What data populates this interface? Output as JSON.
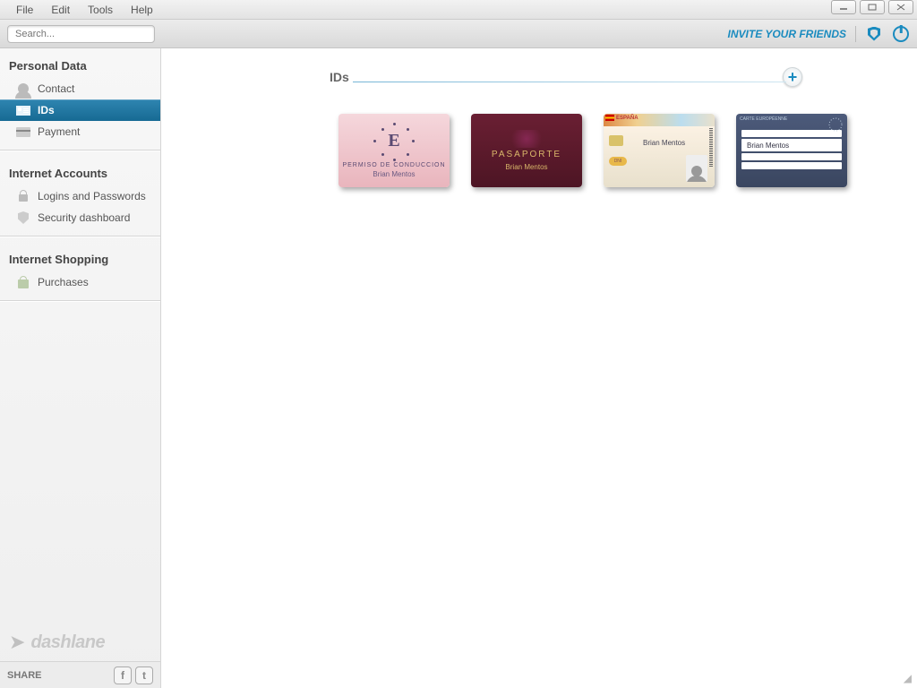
{
  "menu": {
    "file": "File",
    "edit": "Edit",
    "tools": "Tools",
    "help": "Help"
  },
  "search": {
    "placeholder": "Search..."
  },
  "header": {
    "invite": "INVITE YOUR FRIENDS"
  },
  "sidebar": {
    "personal": {
      "title": "Personal Data",
      "contact": "Contact",
      "ids": "IDs",
      "payment": "Payment"
    },
    "internet": {
      "title": "Internet Accounts",
      "logins": "Logins and Passwords",
      "security": "Security dashboard"
    },
    "shopping": {
      "title": "Internet Shopping",
      "purchases": "Purchases"
    },
    "brand": "dashlane",
    "share": "SHARE"
  },
  "page": {
    "title": "IDs"
  },
  "cards": {
    "drivers": {
      "type": "PERMISO DE CONDUCCION",
      "name": "Brian Mentos",
      "big": "E"
    },
    "passport": {
      "type": "PASAPORTE",
      "name": "Brian Mentos"
    },
    "idcard": {
      "country": "ESPAÑA",
      "name": "Brian Mentos",
      "dni": "DNI"
    },
    "health": {
      "name": "Brian Mentos"
    }
  }
}
